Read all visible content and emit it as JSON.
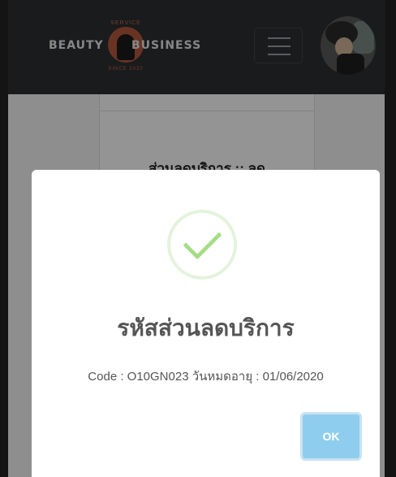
{
  "brand": {
    "word_left": "BEAUTY",
    "word_right": "BUSINESS",
    "tag_top": "SERVICE",
    "tag_bottom": "SINCE 2020",
    "accent_color": "#b5583d"
  },
  "header": {
    "menu_icon": "hamburger-icon",
    "header_color": "#2b2f33"
  },
  "page": {
    "card_heading": "ส่วนลดบริการ :: ลด"
  },
  "dialog": {
    "icon": "checkmark-icon",
    "title": "รหัสส่วนลดบริการ",
    "message": "Code : O10GN023 วันหมดอายุ : 01/06/2020",
    "ok_label": "OK",
    "ok_color": "#8fcdee",
    "check_color": "#a5dc86"
  }
}
